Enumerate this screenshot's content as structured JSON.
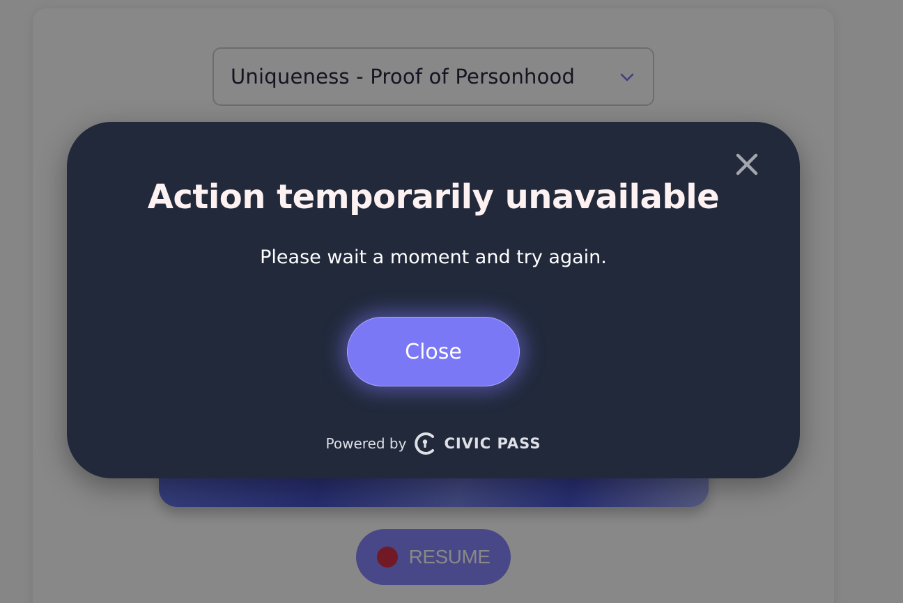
{
  "page": {
    "select": {
      "value": "Uniqueness - Proof of Personhood",
      "icon": "chevron-down-icon"
    },
    "resume_button": {
      "label": "RESUME",
      "icon": "record-dot-icon"
    }
  },
  "modal": {
    "title": "Action temporarily unavailable",
    "message": "Please wait a moment and try again.",
    "close_button_label": "Close",
    "close_icon": "close-icon",
    "footer": {
      "powered_by": "Powered by",
      "brand": "CIVIC PASS",
      "brand_icon": "civic-logo-icon"
    }
  },
  "colors": {
    "modal_bg": "#21293b",
    "accent": "#7a78f5",
    "title": "#fdf1f1",
    "overlay": "rgba(18,18,18,0.5)",
    "record": "#d3203a"
  }
}
